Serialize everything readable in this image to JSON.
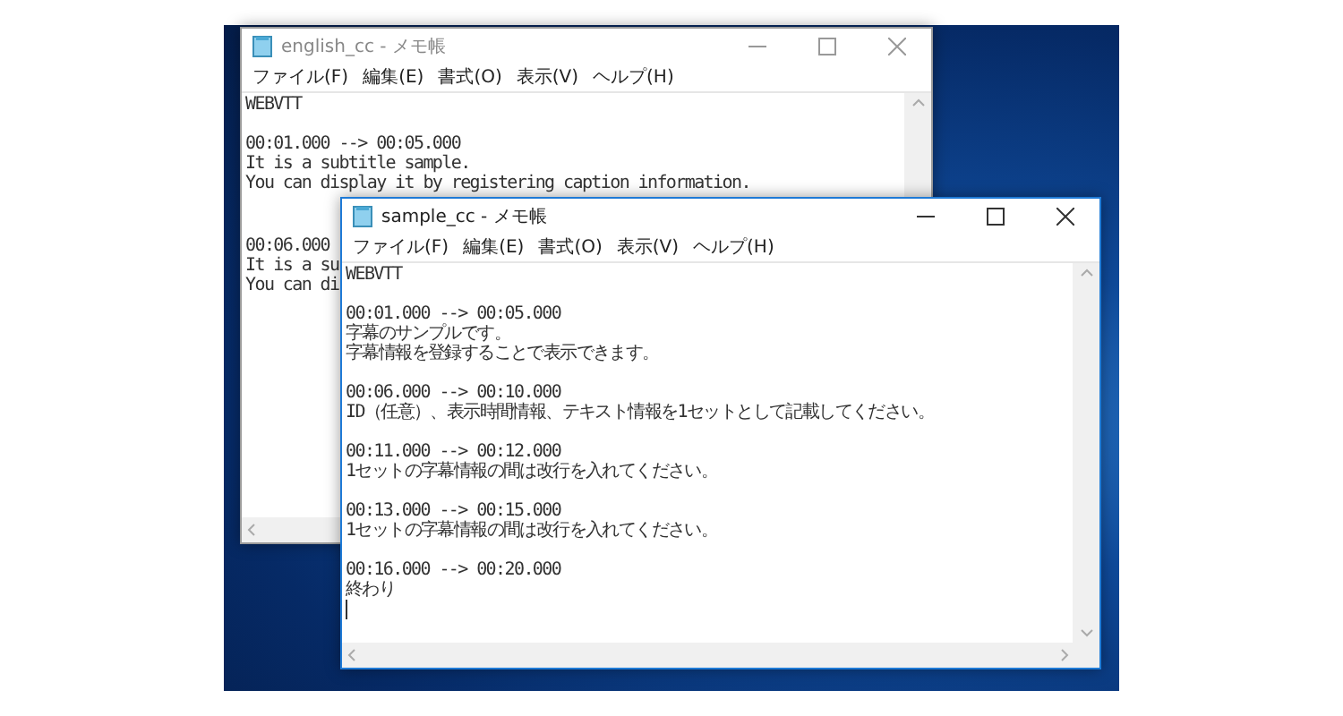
{
  "windows": [
    {
      "title": "english_cc - メモ帳",
      "active": false,
      "menu": [
        "ファイル(F)",
        "編集(E)",
        "書式(O)",
        "表示(V)",
        "ヘルプ(H)"
      ],
      "blocks": [
        {
          "lines": [
            "WEBVTT"
          ]
        },
        {
          "lines": [
            "00:01.000 --> 00:05.000",
            "It is a subtitle sample.",
            "You can display it by registering caption information."
          ]
        },
        {
          "lines": [
            "00:06.000",
            "It is a su",
            "You can di"
          ],
          "extra_space": true
        }
      ],
      "caret": false
    },
    {
      "title": "sample_cc - メモ帳",
      "active": true,
      "menu": [
        "ファイル(F)",
        "編集(E)",
        "書式(O)",
        "表示(V)",
        "ヘルプ(H)"
      ],
      "blocks": [
        {
          "lines": [
            "WEBVTT"
          ]
        },
        {
          "lines": [
            "00:01.000 --> 00:05.000",
            "字幕のサンプルです。",
            "字幕情報を登録することで表示できます。"
          ]
        },
        {
          "lines": [
            "00:06.000 --> 00:10.000",
            "ID（任意）、表示時間情報、テキスト情報を1セットとして記載してください。"
          ]
        },
        {
          "lines": [
            "00:11.000 --> 00:12.000",
            "1セットの字幕情報の間は改行を入れてください。"
          ]
        },
        {
          "lines": [
            "00:13.000 --> 00:15.000",
            "1セットの字幕情報の間は改行を入れてください。"
          ]
        },
        {
          "lines": [
            "00:16.000 --> 00:20.000",
            "終わり"
          ]
        }
      ],
      "caret": true
    }
  ]
}
